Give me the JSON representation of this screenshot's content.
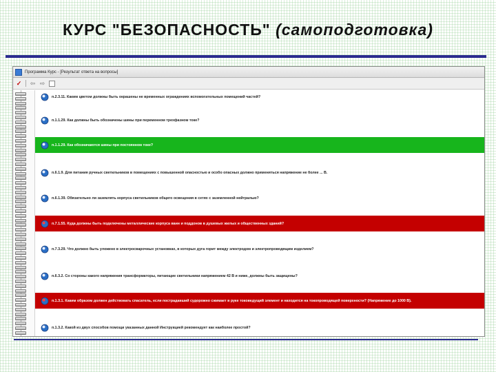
{
  "slide": {
    "title_main": "КУРС \"БЕЗОПАСНОСТЬ\"",
    "title_italic": "(самоподготовка)"
  },
  "window": {
    "title": "Программа Курс - [Результат ответа на вопросы]"
  },
  "colors": {
    "correct": "#17b51c",
    "wrong": "#c40000",
    "accent_rule": "#2b2b8f"
  },
  "toolbar": {
    "items": [
      "check-icon",
      "back-arrow-icon",
      "forward-arrow-icon",
      "stop-icon"
    ]
  },
  "questions": [
    {
      "text": "п.2.3.11. Каким цветом должны быть окрашены не временных ограждениях вспомогательных помещений частей?",
      "status": "none"
    },
    {
      "text": "п.1.1.29. Как должны быть обозначены шины при переменном трехфазном токе?",
      "status": "none"
    },
    {
      "text": "п.1.1.29. Как обозначаются шины при постоянном токе?",
      "status": "correct"
    },
    {
      "text": "п.6.1.9. Для питания ручных светильников в помещениях с повышенной опасностью и особо опасных должно применяться напряжение не более ... В.",
      "status": "none"
    },
    {
      "text": "п.6.1.39. Обязательно ли заземлять корпуса светильников общего освещения в сетях с заземленной нейтралью?",
      "status": "none"
    },
    {
      "text": "п.7.1.55. Куда должны быть подключены металлические корпуса ванн и поддонов в душевых жилых и общественных зданий?",
      "status": "wrong"
    },
    {
      "text": "п.7.3.29. Что должно быть уложено в электросварочных установках, в которых дуга горит между электродом и электропроводящим изделием?",
      "status": "none"
    },
    {
      "text": "п.6.3.2. Со стороны какого напряжения трансформаторы, питающие светильники напряжением 42 В и ниже, должны быть защищены?",
      "status": "none"
    },
    {
      "text": "п.1.3.1. Каким образом должен действовать спасатель, если пострадавший судорожно сжимает в руке токоведущий элемент и находится на токопроводящей поверхности? (Напряжение до 1000 В).",
      "status": "wrong"
    },
    {
      "text": "п.1.3.2. Какой из двух способов помощи указанных данной Инструкцией рекомендует как наиболее простой?",
      "status": "none"
    }
  ]
}
